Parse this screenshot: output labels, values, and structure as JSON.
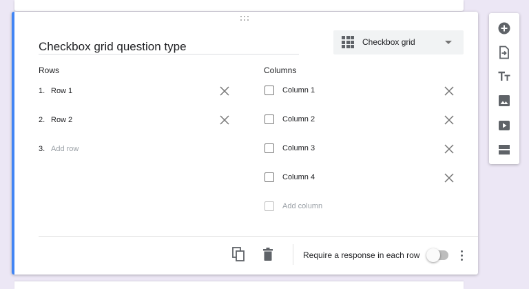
{
  "question": {
    "title": "Checkbox grid question type",
    "type_label": "Checkbox grid",
    "type_icon": "grid-icon"
  },
  "rows": {
    "heading": "Rows",
    "items": [
      {
        "num": "1.",
        "label": "Row 1"
      },
      {
        "num": "2.",
        "label": "Row 2"
      }
    ],
    "add": {
      "num": "3.",
      "label": "Add row"
    }
  },
  "columns": {
    "heading": "Columns",
    "items": [
      {
        "label": "Column 1"
      },
      {
        "label": "Column 2"
      },
      {
        "label": "Column 3"
      },
      {
        "label": "Column 4"
      }
    ],
    "add": {
      "label": "Add column"
    }
  },
  "footer": {
    "require_label": "Require a response in each row",
    "require_on": false
  },
  "toolbar": {
    "items": [
      "add-question-icon",
      "import-questions-icon",
      "add-title-icon",
      "add-image-icon",
      "add-video-icon",
      "add-section-icon"
    ]
  },
  "colors": {
    "accent": "#4285f4",
    "background": "#ece7f5",
    "icon": "#5f6368"
  }
}
